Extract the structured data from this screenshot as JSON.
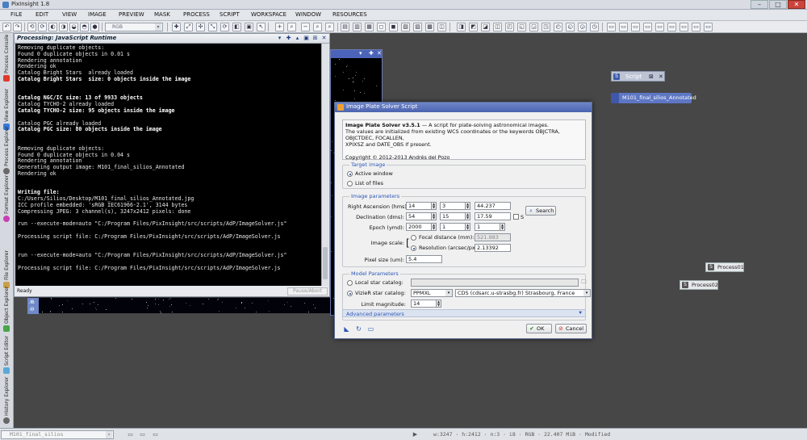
{
  "window": {
    "title": "PixInsight 1.8"
  },
  "menu": [
    "FILE",
    "EDIT",
    "VIEW",
    "IMAGE",
    "PREVIEW",
    "MASK",
    "PROCESS",
    "SCRIPT",
    "WORKSPACE",
    "WINDOW",
    "RESOURCES"
  ],
  "toolbar": {
    "rgb_combo": "RGB"
  },
  "sidebar": [
    "Process Console",
    "View Explorer",
    "Process Explorer",
    "Format Explorer",
    "File Explorer",
    "Object Explorer",
    "Script Editor",
    "History Explorer"
  ],
  "console": {
    "title": "Processing: JavaScript Runtime",
    "lines": [
      {
        "t": "Removing duplicate objects:",
        "b": false
      },
      {
        "t": "Found 0 duplicate objects in 0.01 s",
        "b": false
      },
      {
        "t": "Rendering annotation",
        "b": false
      },
      {
        "t": "Rendering ok",
        "b": false
      },
      {
        "t": "Catalog Bright Stars  already loaded",
        "b": false
      },
      {
        "t": "Catalog Bright Stars  size: 0 objects inside the image",
        "b": true
      },
      {
        "t": "",
        "b": false
      },
      {
        "t": "",
        "b": false
      },
      {
        "t": "Catalog NGC/IC size: 13 of 9933 objects",
        "b": true
      },
      {
        "t": "Catalog TYCHO-2 already loaded",
        "b": false
      },
      {
        "t": "Catalog TYCHO-2 size: 95 objects inside the image",
        "b": true
      },
      {
        "t": "",
        "b": false
      },
      {
        "t": "Catalog PGC already loaded",
        "b": false
      },
      {
        "t": "Catalog PGC size: 80 objects inside the image",
        "b": true
      },
      {
        "t": "",
        "b": false
      },
      {
        "t": "",
        "b": false
      },
      {
        "t": "Removing duplicate objects:",
        "b": false
      },
      {
        "t": "Found 0 duplicate objects in 0.04 s",
        "b": false
      },
      {
        "t": "Rendering annotation",
        "b": false
      },
      {
        "t": "Generating output image: M101_final_silios_Annotated",
        "b": false
      },
      {
        "t": "Rendering ok",
        "b": false
      },
      {
        "t": "",
        "b": false
      },
      {
        "t": "",
        "b": false
      },
      {
        "t": "Writing file:",
        "b": true
      },
      {
        "t": "C:/Users/Silios/Desktop/M101_final_silios_Annotated.jpg",
        "b": false
      },
      {
        "t": "ICC profile embedded: 'sRGB IEC61966-2.1', 3144 bytes",
        "b": false
      },
      {
        "t": "Compressing JPEG: 3 channel(s), 3247x2412 pixels: done",
        "b": false
      },
      {
        "t": "",
        "b": false
      },
      {
        "t": "run --execute-mode=auto \"C:/Program Files/PixInsight/src/scripts/AdP/ImageSolver.js\"",
        "b": false
      },
      {
        "t": "",
        "b": false
      },
      {
        "t": "Processing script file: C:/Program Files/PixInsight/src/scripts/AdP/ImageSolver.js",
        "b": false
      },
      {
        "t": "",
        "b": false
      },
      {
        "t": "",
        "b": false
      },
      {
        "t": "run --execute-mode=auto \"C:/Program Files/PixInsight/src/scripts/AdP/ImageSolver.js\"",
        "b": false
      },
      {
        "t": "",
        "b": false
      },
      {
        "t": "Processing script file: C:/Program Files/PixInsight/src/scripts/AdP/ImageSolver.js",
        "b": false
      }
    ],
    "status": "Ready",
    "pause_button": "Pause/Abort"
  },
  "workspace": {
    "script_window": "Script",
    "image_icon": "M101_final_silios_Annotated",
    "process_icons": [
      "Process01",
      "Process02"
    ]
  },
  "dialog": {
    "title": "Image Plate Solver Script",
    "info_heading": "Image Plate Solver v3.5.1",
    "info_heading_rest": " — A script for plate-solving astronomical images.",
    "info_lines": [
      "The values are initialized from existing WCS coordinates or the keywords OBJCTRA, OBJCTDEC, FOCALLEN,",
      "XPIXSZ and DATE_OBS if present."
    ],
    "copyright": "Copyright © 2012-2013 Andrés del Pozo",
    "target": {
      "label": "Target image",
      "active_window": "Active window",
      "list_of_files": "List of files"
    },
    "params": {
      "label": "Image parameters",
      "ra_label": "Right Ascension (hms):",
      "ra": [
        "14",
        "3",
        "44.237"
      ],
      "dec_label": "Declination (dms):",
      "dec": [
        "54",
        "15",
        "17.59"
      ],
      "south": "S",
      "epoch_label": "Epoch (ymd):",
      "epoch": [
        "2000",
        "1",
        "1"
      ],
      "search": "Search",
      "scale_label": "Image scale:",
      "focal_label": "Focal distance (mm):",
      "focal": "521.983",
      "res_label": "Resolution (arcsec/px):",
      "res": "2.13392",
      "pixel_label": "Pixel size (um):",
      "pixel": "5.4"
    },
    "model": {
      "label": "Model Parameters",
      "local_label": "Local star catalog:",
      "vizier_label": "VizieR star catalog:",
      "vizier_catalog": "PPMXL",
      "server": "CDS (cdsarc.u-strasbg.fr) Strasbourg, France",
      "limit_label": "Limit magnitude:",
      "limit": "14",
      "advanced": "Advanced parameters"
    },
    "ok": "OK",
    "cancel": "Cancel"
  },
  "statusbar": {
    "view": "M101_final_silios",
    "info": "w:3247 · h:2412 · n:3 · i8 · RGB · 22.407 MiB · Modified"
  }
}
